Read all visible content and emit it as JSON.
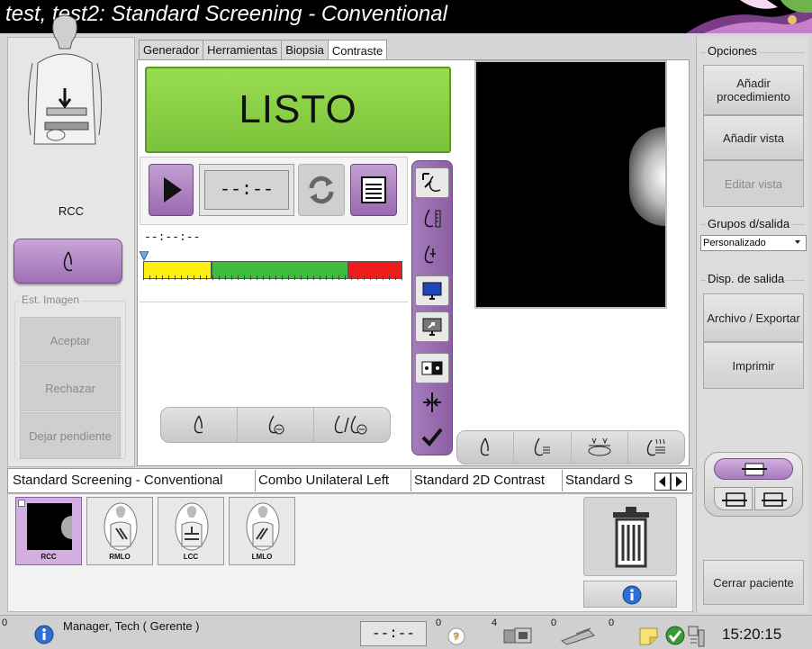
{
  "window": {
    "title": "test, test2:  Standard Screening - Conventional"
  },
  "left_panel": {
    "view_label": "RCC",
    "image_status": {
      "legend": "Est. Imagen",
      "accept": "Aceptar",
      "reject": "Rechazar",
      "pending": "Dejar pendiente"
    }
  },
  "tabs": [
    {
      "label": "Generador",
      "active": false
    },
    {
      "label": "Herramientas",
      "active": false
    },
    {
      "label": "Biopsia",
      "active": false
    },
    {
      "label": "Contraste",
      "active": true
    }
  ],
  "status_panel": {
    "state": "LISTO",
    "timer": "--:--",
    "elapsed": "--:--:--"
  },
  "right_panel": {
    "options_label": "Opciones",
    "add_procedure": "Añadir procedimiento",
    "add_view": "Añadir vista",
    "edit_view": "Editar vista",
    "output_groups_label": "Grupos d/salida",
    "output_group_selected": "Personalizado",
    "output_devices_label": "Disp. de salida",
    "archive_export": "Archivo / Exportar",
    "print": "Imprimir",
    "close_patient": "Cerrar paciente"
  },
  "procedure_tabs": [
    "Standard Screening - Conventional",
    "Combo Unilateral Left",
    "Standard 2D Contrast",
    "Standard S"
  ],
  "thumbnails": [
    {
      "label": "RCC",
      "active": true
    },
    {
      "label": "RMLO",
      "active": false
    },
    {
      "label": "LCC",
      "active": false
    },
    {
      "label": "LMLO",
      "active": false
    }
  ],
  "status_bar": {
    "left_num": "0",
    "user": "Manager, Tech ( Gerente )",
    "timer": "--:--",
    "count_a": "0",
    "count_b": "4",
    "count_c": "0",
    "count_d": "0",
    "clock": "15:20:15"
  },
  "colors": {
    "accent_purple": "#9a6ab0",
    "ready_green": "#7cc23a",
    "bar_yellow": "#ffef10",
    "bar_green": "#3fbb3f",
    "bar_red": "#f01b1b"
  }
}
